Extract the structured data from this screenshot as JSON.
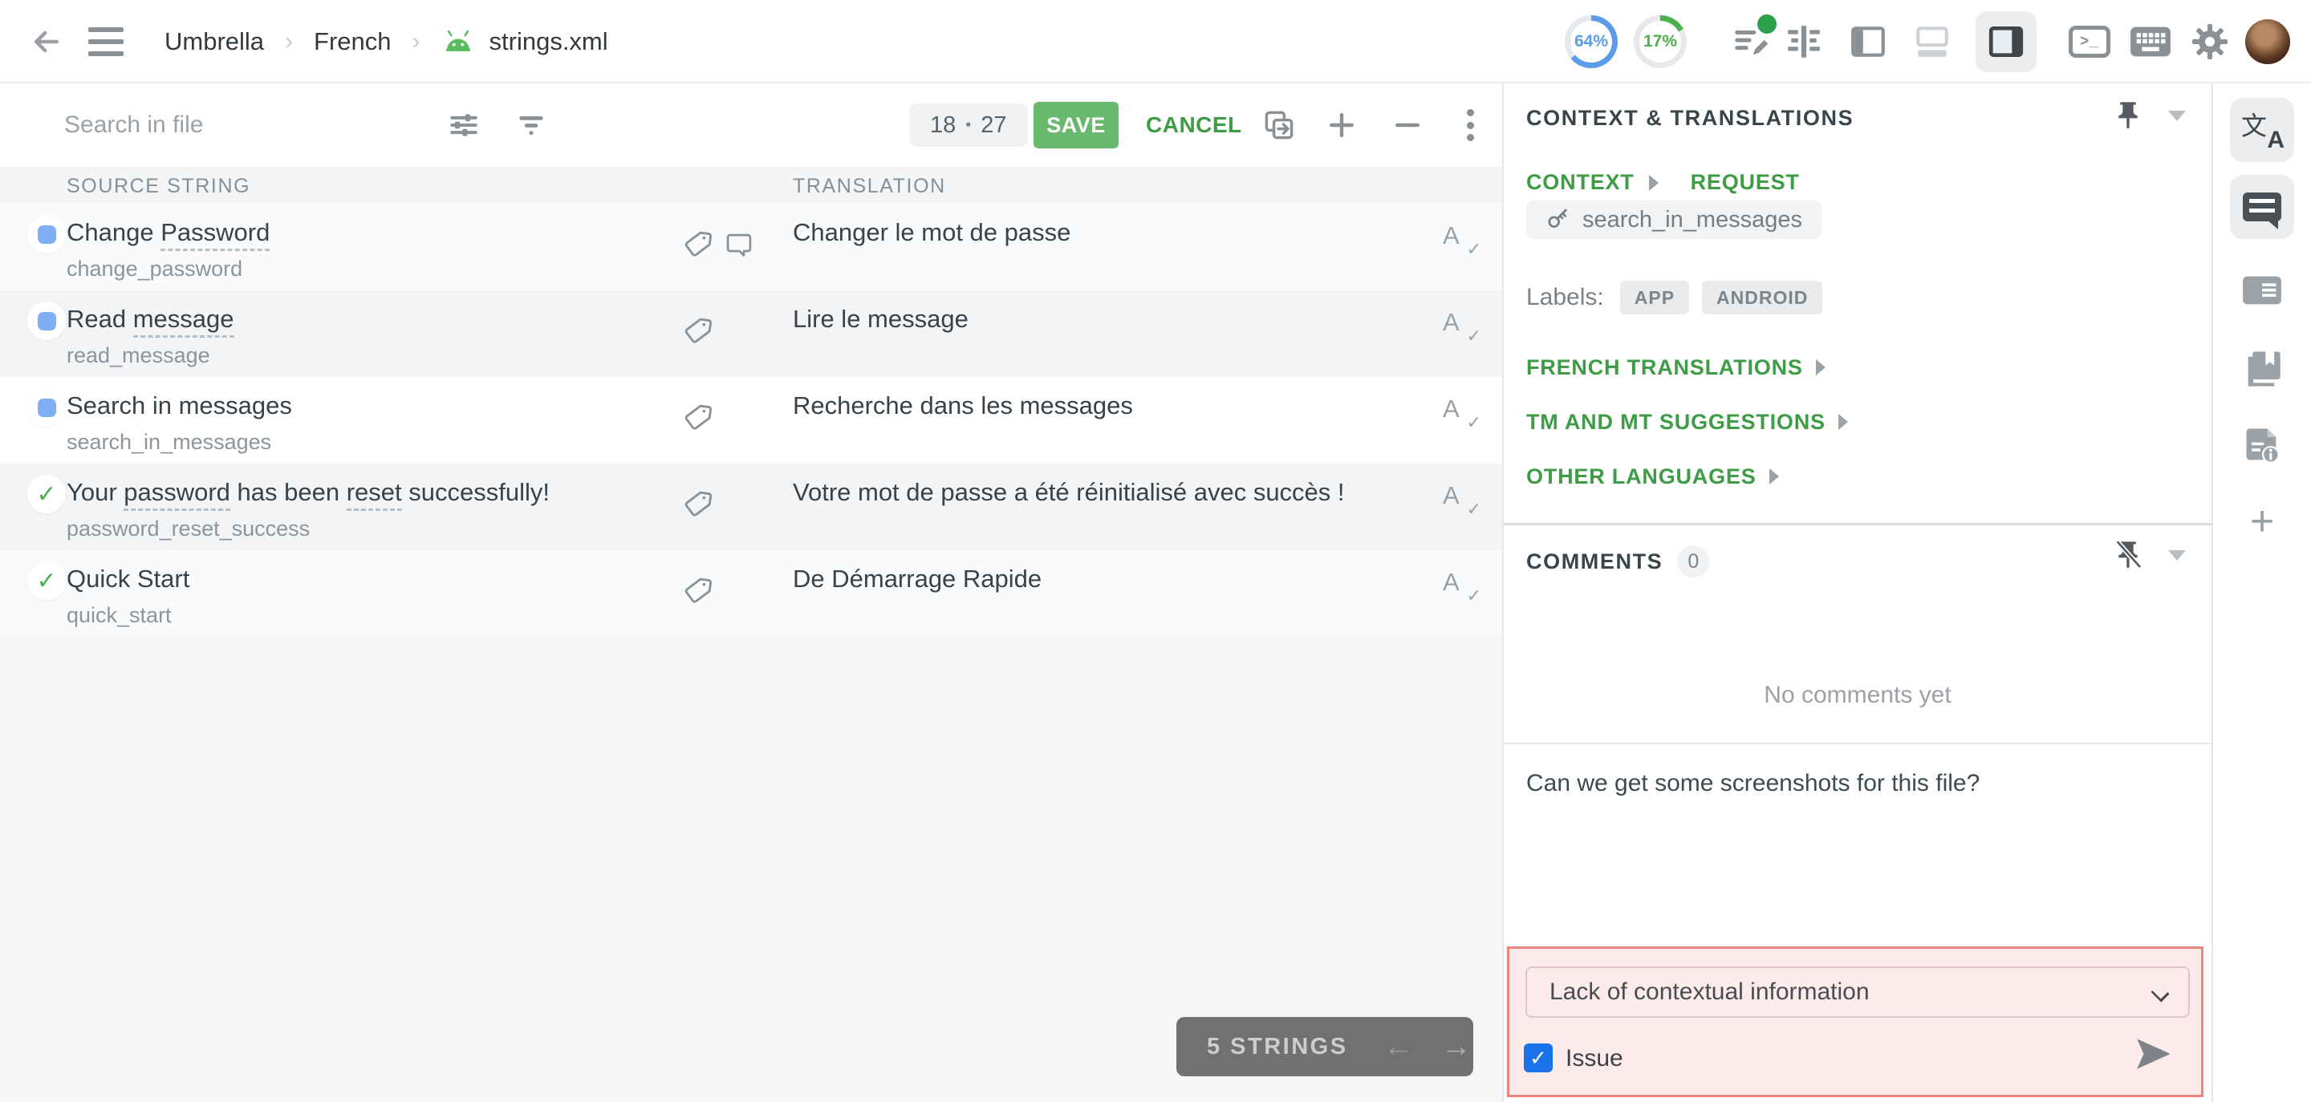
{
  "topbar": {
    "breadcrumb": [
      "Umbrella",
      "French",
      "strings.xml"
    ],
    "progress": [
      {
        "value": "64%",
        "color": "#5b9bea",
        "track": "#e4e9ee"
      },
      {
        "value": "17%",
        "color": "#4caf50",
        "track": "#e6e8e9"
      }
    ]
  },
  "toolbar": {
    "search_placeholder": "Search in file",
    "counter_current": "18",
    "counter_separator": "•",
    "counter_total": "27",
    "save_label": "SAVE",
    "cancel_label": "CANCEL"
  },
  "table": {
    "columns": [
      "SOURCE STRING",
      "TRANSLATION"
    ],
    "rows": [
      {
        "status": "todo",
        "shade": "a",
        "source": [
          {
            "text": "Change ",
            "term": false
          },
          {
            "text": "Password",
            "term": true
          }
        ],
        "key": "change_password",
        "translation": "Changer le mot de passe",
        "has_comment": true
      },
      {
        "status": "todo",
        "shade": "b",
        "source": [
          {
            "text": "Read ",
            "term": false
          },
          {
            "text": "message",
            "term": true
          }
        ],
        "key": "read_message",
        "translation": "Lire le message",
        "has_comment": false
      },
      {
        "status": "todo",
        "shade": "selected",
        "source": [
          {
            "text": "Search in messages",
            "term": false
          }
        ],
        "key": "search_in_messages",
        "translation": "Recherche dans les messages",
        "has_comment": false
      },
      {
        "status": "done",
        "shade": "b",
        "source": [
          {
            "text": "Your ",
            "term": false
          },
          {
            "text": "password",
            "term": true
          },
          {
            "text": " has been ",
            "term": false
          },
          {
            "text": "reset",
            "term": true
          },
          {
            "text": " successfully!",
            "term": false
          }
        ],
        "key": "password_reset_success",
        "translation": "Votre mot de passe a été réinitialisé avec succès !",
        "has_comment": false
      },
      {
        "status": "done",
        "shade": "a",
        "source": [
          {
            "text": "Quick Start",
            "term": false
          }
        ],
        "key": "quick_start",
        "translation": "De Démarrage Rapide",
        "has_comment": false
      }
    ],
    "done_check": "✓"
  },
  "footer": {
    "strings_count_label": "5 STRINGS",
    "prev_arrow": "←",
    "next_arrow": "→"
  },
  "context_panel": {
    "title": "CONTEXT & TRANSLATIONS",
    "tab_context": "CONTEXT",
    "tab_request": "REQUEST",
    "string_key": "search_in_messages",
    "labels_caption": "Labels:",
    "labels": [
      "APP",
      "ANDROID"
    ],
    "sections": [
      "FRENCH TRANSLATIONS",
      "TM AND MT SUGGESTIONS",
      "OTHER LANGUAGES"
    ]
  },
  "comments_panel": {
    "title": "COMMENTS",
    "count": "0",
    "empty_text": "No comments yet",
    "draft_text": "Can we get some screenshots for this file?",
    "issue_type_selected": "Lack of contextual information",
    "issue_label": "Issue",
    "issue_checked": "✓"
  },
  "colors": {
    "accent_green": "#3d9c45",
    "save_green": "#68b96d",
    "error_red": "#f0837b",
    "checkbox_blue": "#1a73e8"
  }
}
